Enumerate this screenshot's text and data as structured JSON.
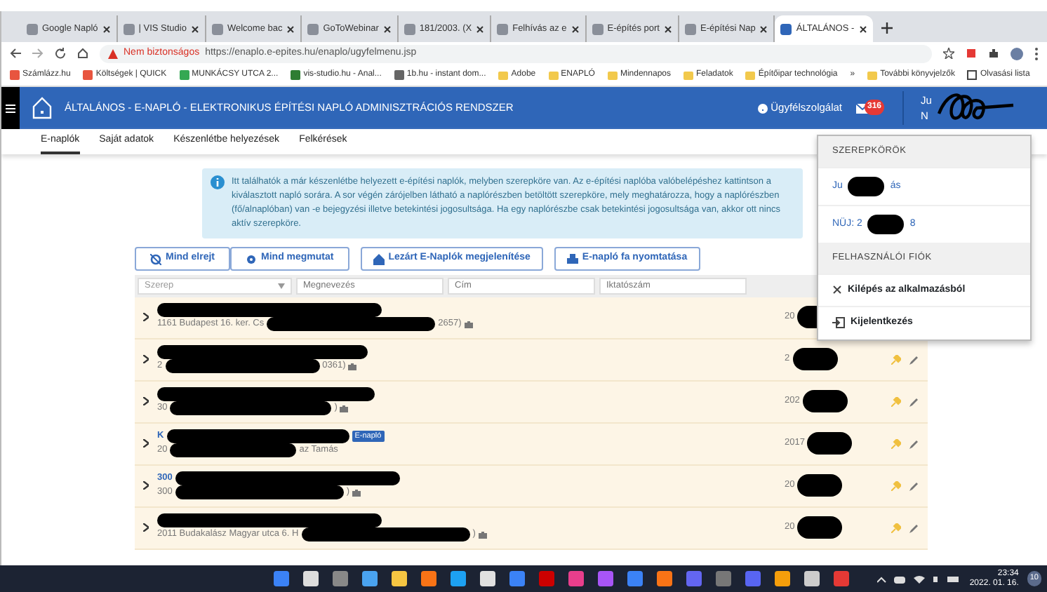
{
  "browser": {
    "tabs": [
      {
        "title": "Google Napló",
        "selected": false
      },
      {
        "title": "| VIS Studio",
        "selected": false
      },
      {
        "title": "Welcome bac",
        "selected": false
      },
      {
        "title": "GoToWebinar",
        "selected": false
      },
      {
        "title": "181/2003. (X",
        "selected": false
      },
      {
        "title": "Felhívás az e",
        "selected": false
      },
      {
        "title": "E-építés port",
        "selected": false
      },
      {
        "title": "E-építési Nap",
        "selected": false
      },
      {
        "title": "ÁLTALÁNOS -",
        "selected": true
      }
    ],
    "address": {
      "warning": "Nem biztonságos",
      "url": "https://enaplo.e-epites.hu/enaplo/ugyfelmenu.jsp"
    },
    "bookmarks": [
      {
        "label": "Számlázz.hu"
      },
      {
        "label": "Költségek | QUICK"
      },
      {
        "label": "MUNKÁCSY UTCA 2..."
      },
      {
        "label": "vis-studio.hu - Anal..."
      },
      {
        "label": "1b.hu - instant dom..."
      },
      {
        "label": "Adobe"
      },
      {
        "label": "ENAPLÓ"
      },
      {
        "label": "Mindennapos"
      },
      {
        "label": "Feladatok"
      },
      {
        "label": "Építőipar technológia"
      }
    ],
    "bookmarks_more": "»",
    "other_bookmarks": "További könyvjelzők",
    "reading_list": "Olvasási lista"
  },
  "app": {
    "title": "ÁLTALÁNOS - E-NAPLÓ - ELEKTRONIKUS ÉPÍTÉSI NAPLÓ ADMINISZTRÁCIÓS RENDSZER",
    "support": "Ügyfélszolgálat",
    "mail_count": "316",
    "user_lines": [
      "Ju",
      "N"
    ],
    "nav": [
      {
        "label": "E-naplók",
        "selected": true
      },
      {
        "label": "Saját adatok",
        "selected": false
      },
      {
        "label": "Készenlétbe helyezések",
        "selected": false
      },
      {
        "label": "Felkérések",
        "selected": false
      }
    ],
    "info": "Itt találhatók a már készenlétbe helyezett e-építési naplók, melyben szerepköre van. Az e-építési naplóba valóbelépéshez kattintson a kiválasztott napló sorára. A sor végén zárójelben látható a naplórészben betöltött szerepköre, mely meghatározza, hogy a naplórészben (fő/alnaplóban) van -e bejegyzési illetve betekintési jogosultsága. Ha egy naplórészbe csak betekintési jogosultsága van, akkor ott nincs aktív szerepköre.",
    "buttons": [
      {
        "label": "Mind elrejt"
      },
      {
        "label": "Mind megmutat"
      },
      {
        "label": "Lezárt E-Naplók megjelenítése"
      },
      {
        "label": "E-napló fa nyomtatása"
      }
    ],
    "filters": [
      {
        "placeholder": "Szerep",
        "kind": "select"
      },
      {
        "placeholder": "Megnevezés",
        "kind": "text"
      },
      {
        "placeholder": "Cím",
        "kind": "text"
      },
      {
        "placeholder": "Iktatószám",
        "kind": "text"
      }
    ],
    "rows": [
      {
        "address": "1161 Budapest 16. ker. Cs",
        "tail": "2657)",
        "date": "20"
      },
      {
        "address": "2",
        "tail": "0361)",
        "date": "2"
      },
      {
        "address": "30",
        "tail": ")",
        "date": "202"
      },
      {
        "title": "K",
        "badge": "E-napló",
        "address": "20",
        "tail": "az Tamás",
        "date": "2017"
      },
      {
        "title": "300",
        "address": "300",
        "tail": ")",
        "date": "20"
      },
      {
        "address": "2011 Budakalász Magyar utca 6. H",
        "tail": ")",
        "date": "20"
      }
    ],
    "menu": [
      {
        "heading": "SZEREPKÖRÖK",
        "items": [
          {
            "kind": "role",
            "text": "Ju",
            "tail": "ás"
          },
          {
            "kind": "role",
            "text": "NÜJ: 2",
            "tail": "8"
          }
        ]
      },
      {
        "heading": "FELHASZNÁLÓI FIÓK",
        "items": [
          {
            "kind": "exit",
            "text": "Kilépés az alkalmazásból"
          },
          {
            "kind": "logout",
            "text": "Kijelentkezés"
          }
        ]
      }
    ]
  },
  "taskbar": {
    "time": "23:34",
    "date": "2022. 01. 16.",
    "notification_count": "10"
  }
}
